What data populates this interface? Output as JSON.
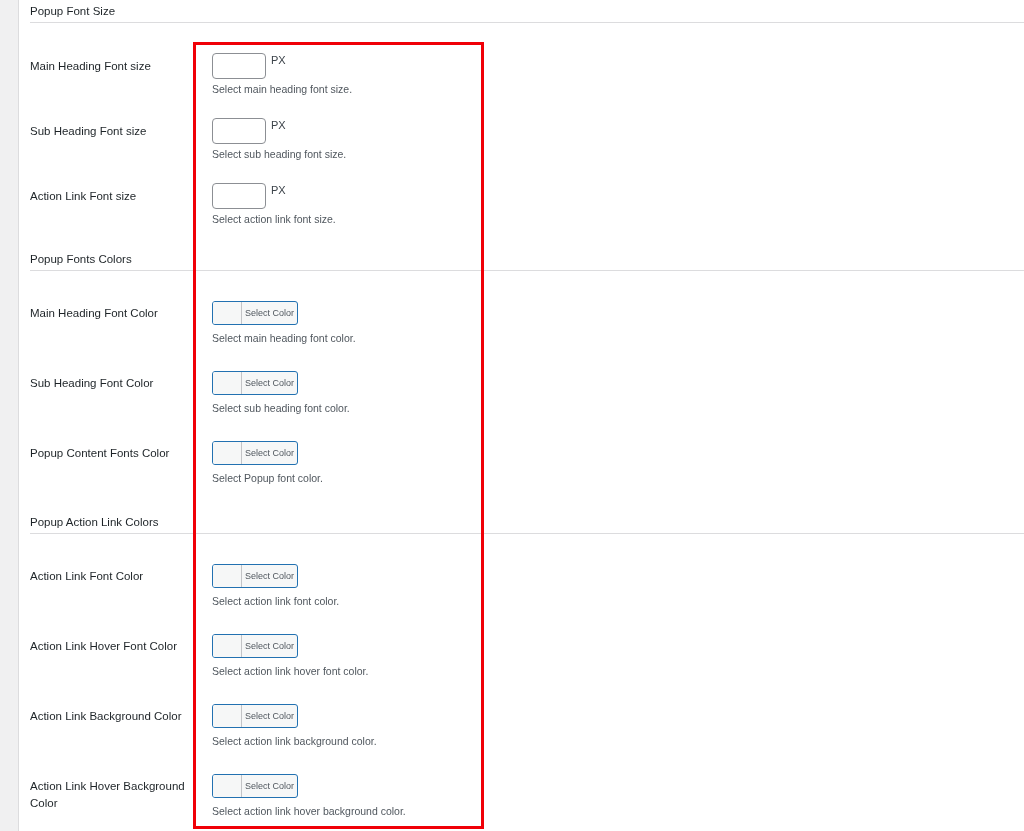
{
  "sections": [
    {
      "title": "Popup Font Size",
      "fields": [
        {
          "kind": "size",
          "label": "Main Heading Font size",
          "unit": "PX",
          "description": "Select main heading font size."
        },
        {
          "kind": "size",
          "label": "Sub Heading Font size",
          "unit": "PX",
          "description": "Select sub heading font size."
        },
        {
          "kind": "size",
          "label": "Action Link Font size",
          "unit": "PX",
          "description": "Select action link font size."
        }
      ]
    },
    {
      "title": "Popup Fonts Colors",
      "fields": [
        {
          "kind": "color",
          "label": "Main Heading Font Color",
          "button": "Select Color",
          "description": "Select main heading font color."
        },
        {
          "kind": "color",
          "label": "Sub Heading Font Color",
          "button": "Select Color",
          "description": "Select sub heading font color."
        },
        {
          "kind": "color",
          "label": "Popup Content Fonts Color",
          "button": "Select Color",
          "description": "Select Popup font color."
        }
      ]
    },
    {
      "title": "Popup Action Link Colors",
      "fields": [
        {
          "kind": "color",
          "label": "Action Link Font Color",
          "button": "Select Color",
          "description": "Select action link font color."
        },
        {
          "kind": "color",
          "label": "Action Link Hover Font Color",
          "button": "Select Color",
          "description": "Select action link hover font color."
        },
        {
          "kind": "color",
          "label": "Action Link Background Color",
          "button": "Select Color",
          "description": "Select action link background color."
        },
        {
          "kind": "color",
          "label": "Action Link Hover Background Color",
          "button": "Select Color",
          "description": "Select action link hover background color."
        }
      ]
    }
  ]
}
